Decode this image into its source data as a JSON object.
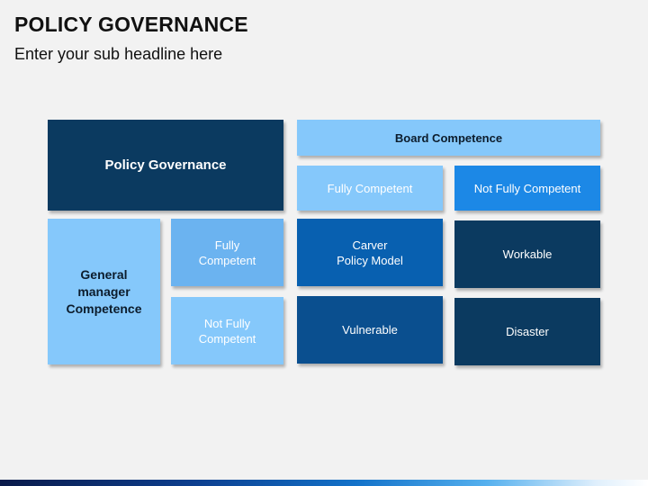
{
  "header": {
    "title": "POLICY GOVERNANCE",
    "subtitle": "Enter your sub headline here"
  },
  "matrix": {
    "corner_label": "Policy Governance",
    "column_header": "Board Competence",
    "columns": [
      "Fully Competent",
      "Not Fully Competent"
    ],
    "row_header": "General\nmanager\nCompetence",
    "rows": [
      "Fully\nCompetent",
      "Not Fully\nCompetent"
    ],
    "cells": [
      [
        "Carver\nPolicy Model",
        "Workable"
      ],
      [
        "Vulnerable",
        "Disaster"
      ]
    ]
  },
  "colors": {
    "dark_navy": "#0b3a60",
    "mid_blue": "#0860b0",
    "bright_blue": "#1c88e6",
    "sky_blue": "#6bb3f0",
    "light_blue": "#85c8fb"
  }
}
